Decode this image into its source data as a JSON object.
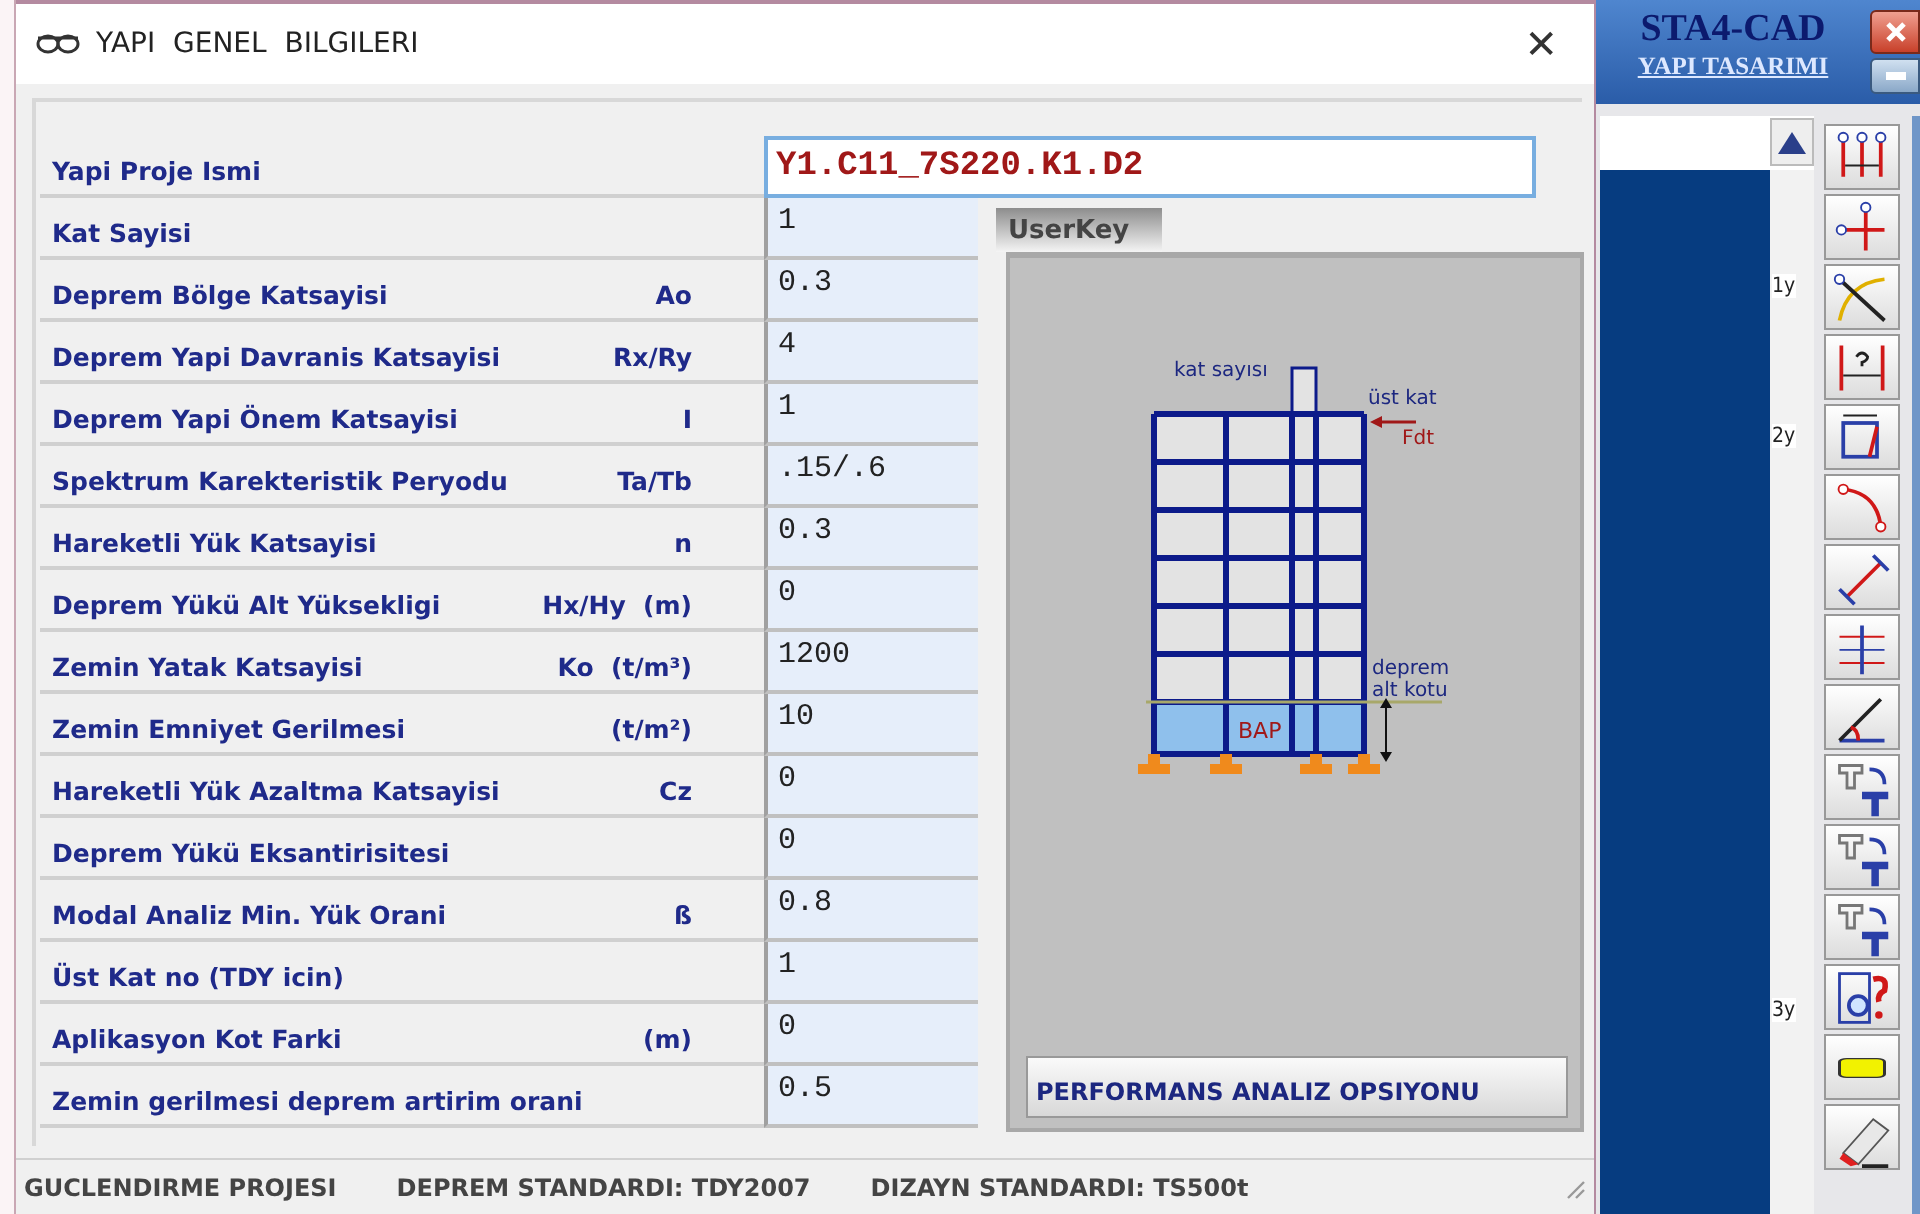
{
  "dialog": {
    "title": "YAPI  GENEL  BILGILERI",
    "close_glyph": "✕",
    "fields": [
      {
        "kind": "input",
        "label": "Yapi Proje Ismi",
        "value": "Y1.C11_7S220.K1.D2"
      },
      {
        "kind": "cell",
        "label": "Kat Sayisi",
        "value": "1"
      },
      {
        "kind": "cell",
        "label": "Deprem Bölge Katsayisi",
        "symbol": "Ao",
        "value": "0.3"
      },
      {
        "kind": "cell",
        "label": "Deprem Yapi Davranis Katsayisi",
        "symbol": "Rx/Ry",
        "value": "4"
      },
      {
        "kind": "cell",
        "label": "Deprem Yapi Önem Katsayisi",
        "symbol": "I",
        "value": "1"
      },
      {
        "kind": "cell",
        "label": "Spektrum Karekteristik Peryodu",
        "symbol": "Ta/Tb",
        "value": ".15/.6"
      },
      {
        "kind": "cell",
        "label": "Hareketli Yük Katsayisi",
        "symbol": "n",
        "value": "0.3"
      },
      {
        "kind": "cell",
        "label": "Deprem Yükü Alt Yüksekligi",
        "symbol": "Hx/Hy  (m)",
        "value": "0"
      },
      {
        "kind": "cell",
        "label": "Zemin Yatak Katsayisi",
        "symbol": "Ko  (t/m³)",
        "value": "1200"
      },
      {
        "kind": "cell",
        "label": "Zemin Emniyet Gerilmesi",
        "symbol": "(t/m²)",
        "value": "10"
      },
      {
        "kind": "cell",
        "label": "Hareketli Yük Azaltma Katsayisi",
        "symbol": "Cz",
        "value": "0"
      },
      {
        "kind": "cell",
        "label": "Deprem Yükü Eksantirisitesi",
        "value": "0"
      },
      {
        "kind": "cell",
        "label": "Modal Analiz Min. Yük Orani",
        "symbol": "ß",
        "value": "0.8"
      },
      {
        "kind": "cell",
        "label": "Üst Kat no (TDY icin)",
        "value": "1"
      },
      {
        "kind": "cell",
        "label": "Aplikasyon Kot Farki",
        "symbol": "(m)",
        "value": "0"
      },
      {
        "kind": "cell",
        "label": "Zemin gerilmesi deprem artirim orani",
        "value": "0.5"
      }
    ],
    "tabs": [
      {
        "label": "UserKey",
        "selected": true
      }
    ],
    "diagram": {
      "floors_label": "kat sayısı",
      "top_label": "üst kat",
      "force_label": "Fdt",
      "base_label_1": "deprem",
      "base_label_2": "alt kotu",
      "basement_label": "BAP"
    },
    "button": "PERFORMANS ANALIZ OPSIYONU",
    "status_bar": [
      "GUCLENDIRME PROJESI",
      "DEPREM STANDARDI: TDY2007",
      "DIZAYN STANDARDI: TS500t"
    ]
  },
  "app": {
    "title": "STA4-CAD",
    "subtitle": "YAPI TASARIMI",
    "ruler_labels": [
      "1y",
      "2y",
      "3y"
    ]
  }
}
